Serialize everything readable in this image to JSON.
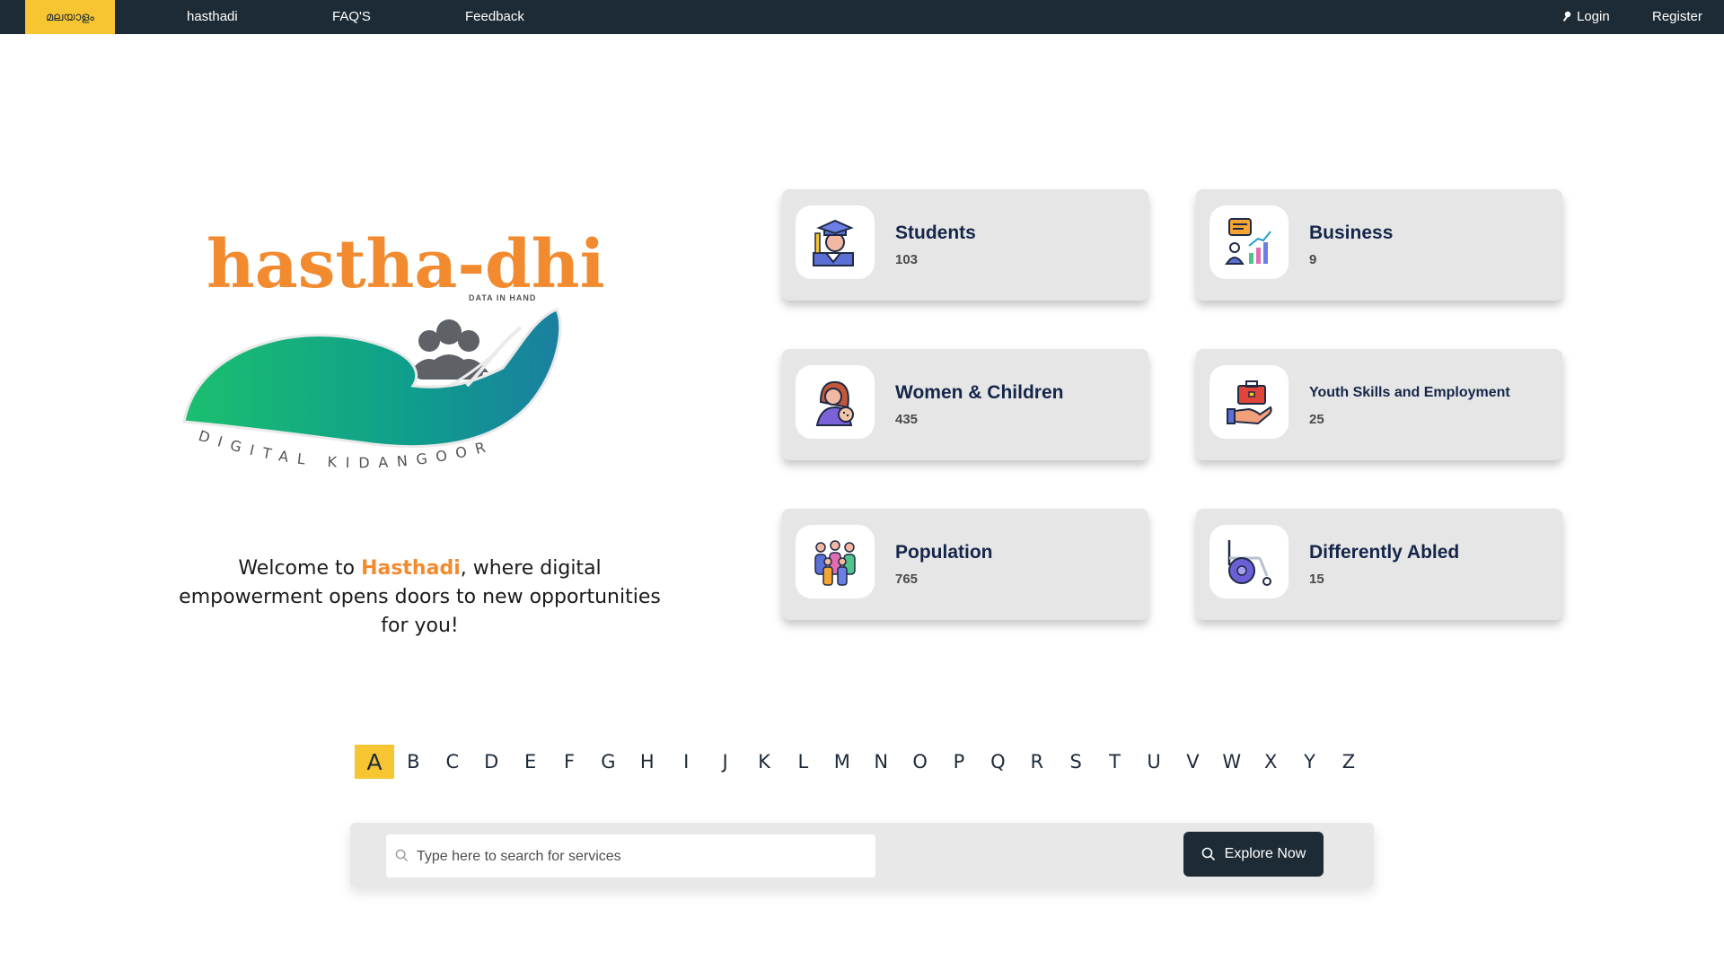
{
  "nav": {
    "language": "മലയാളം",
    "links": [
      "hasthadi",
      "FAQ'S",
      "Feedback"
    ],
    "login": "Login",
    "register": "Register"
  },
  "logo": {
    "wordmark": "hastha-dhi",
    "tagline": "DATA IN HAND",
    "arc_text": "DIGITAL KIDANGOOR"
  },
  "welcome": {
    "prefix": "Welcome to ",
    "brand": "Hasthadi",
    "suffix": ", where digital empowerment opens doors to new opportunities for you!"
  },
  "categories": [
    {
      "title": "Students",
      "count": "103",
      "icon": "student-icon"
    },
    {
      "title": "Business",
      "count": "9",
      "icon": "business-growth-icon"
    },
    {
      "title": "Women & Children",
      "count": "435",
      "icon": "mother-child-icon"
    },
    {
      "title": "Youth Skills and Employment",
      "count": "25",
      "icon": "briefcase-hand-icon"
    },
    {
      "title": "Population",
      "count": "765",
      "icon": "people-group-icon"
    },
    {
      "title": "Differently Abled",
      "count": "15",
      "icon": "wheelchair-icon"
    }
  ],
  "alphabet": [
    "A",
    "B",
    "C",
    "D",
    "E",
    "F",
    "G",
    "H",
    "I",
    "J",
    "K",
    "L",
    "M",
    "N",
    "O",
    "P",
    "Q",
    "R",
    "S",
    "T",
    "U",
    "V",
    "W",
    "X",
    "Y",
    "Z"
  ],
  "alphabet_selected": "A",
  "search": {
    "placeholder": "Type here to search for services",
    "button": "Explore Now"
  },
  "colors": {
    "nav_bg": "#1d2b36",
    "accent_yellow": "#f7c531",
    "brand_orange": "#f28b30",
    "card_bg": "#e6e6e6",
    "title_navy": "#15264a"
  }
}
